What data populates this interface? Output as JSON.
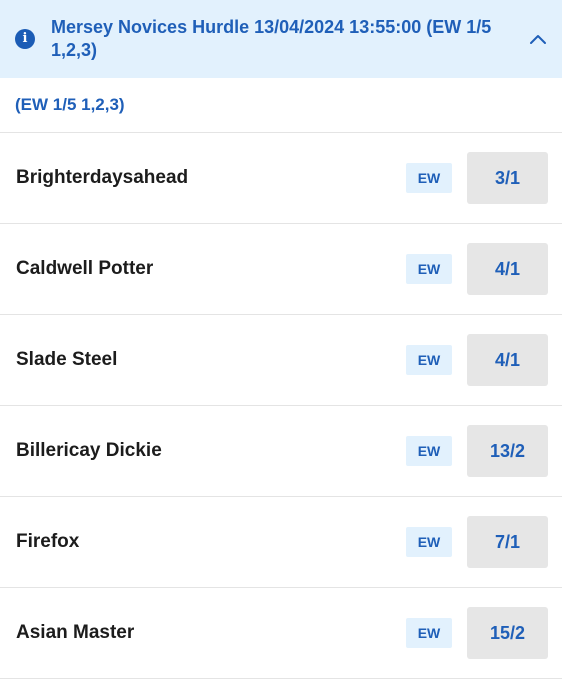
{
  "market": {
    "title": "Mersey Novices Hurdle 13/04/2024 13:55:00 (EW 1/5 1,2,3)",
    "info_icon_glyph": "i",
    "info_icon": "info-icon",
    "collapse_icon": "chevron-up-icon",
    "each_way_terms": "(EW 1/5 1,2,3)"
  },
  "colors": {
    "accent": "#1f5fb8",
    "header_bg": "#e2f1fd",
    "odds_bg": "#e6e6e6"
  },
  "runners": [
    {
      "name": "Brighterdaysahead",
      "ew": "EW",
      "odds": "3/1"
    },
    {
      "name": "Caldwell Potter",
      "ew": "EW",
      "odds": "4/1"
    },
    {
      "name": "Slade Steel",
      "ew": "EW",
      "odds": "4/1"
    },
    {
      "name": "Billericay Dickie",
      "ew": "EW",
      "odds": "13/2"
    },
    {
      "name": "Firefox",
      "ew": "EW",
      "odds": "7/1"
    },
    {
      "name": "Asian Master",
      "ew": "EW",
      "odds": "15/2"
    }
  ]
}
